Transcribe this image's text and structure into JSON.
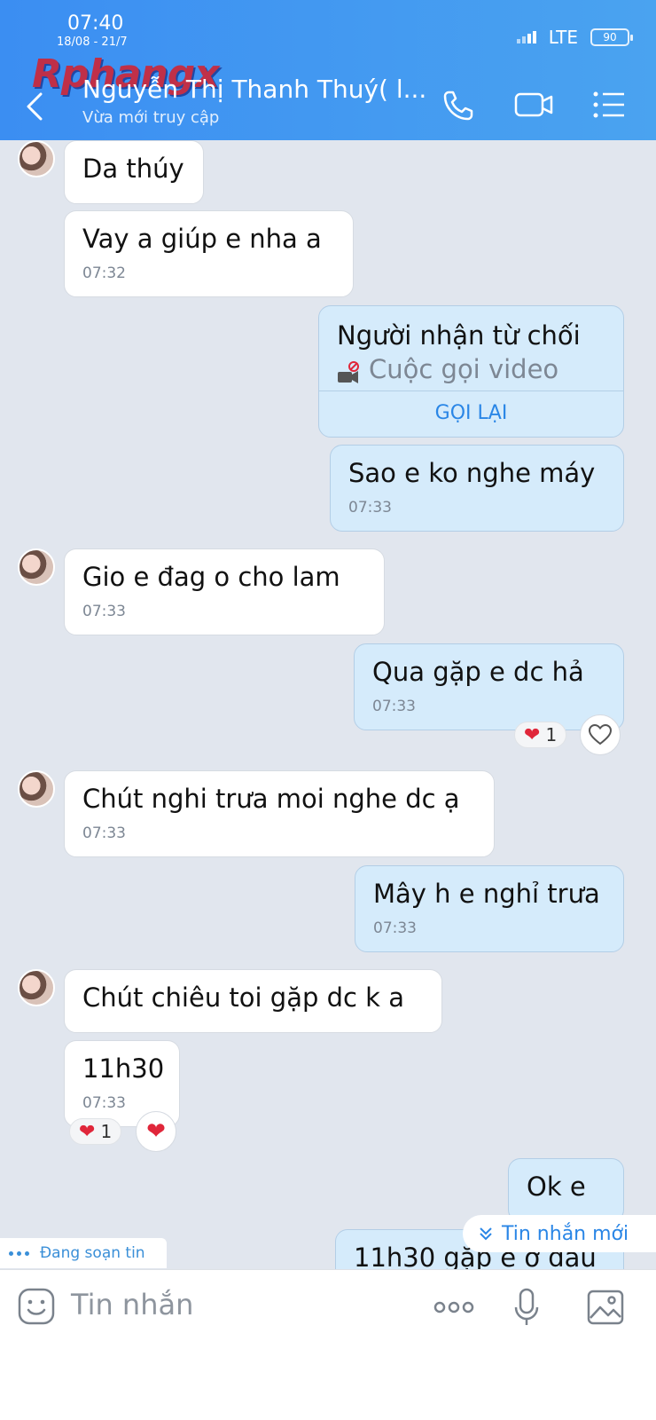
{
  "status": {
    "time": "07:40",
    "date": "18/08 - 21/7",
    "network": "LTE",
    "battery": "90"
  },
  "watermark": "Rphangx",
  "header": {
    "name": "Nguyễn Thị Thanh Thuý( l...",
    "presence": "Vừa mới truy cập"
  },
  "messages": {
    "m1": {
      "text": "Da thúy"
    },
    "m2": {
      "text": "Vay a giúp e nha a",
      "time": "07:32"
    },
    "missed_call": {
      "line1": "Người nhận từ chối",
      "line2": "Cuộc gọi video",
      "action": "GỌI LẠI"
    },
    "m3": {
      "text": "Sao e ko nghe máy",
      "time": "07:33"
    },
    "m4": {
      "text": "Gio e đag o cho lam",
      "time": "07:33"
    },
    "m5": {
      "text": "Qua gặp e dc hả",
      "time": "07:33",
      "reaction_count": "1"
    },
    "m6": {
      "text": "Chút nghi trưa moi nghe dc ạ",
      "time": "07:33"
    },
    "m7": {
      "text": "Mây h e nghỉ trưa",
      "time": "07:33"
    },
    "m8": {
      "text": "Chút chiêu toi gặp dc k a"
    },
    "m9": {
      "text": "11h30",
      "time": "07:33",
      "reaction_count": "1"
    },
    "m10": {
      "text": "Ok e"
    },
    "m11": {
      "text": "11h30 gặp e ở đâu"
    }
  },
  "typing_indicator": "Đang soạn tin",
  "new_message_label": "Tin nhắn mới",
  "input": {
    "placeholder": "Tin nhắn"
  },
  "colors": {
    "header": "#3b8ef2",
    "outgoing": "#d5ebfb",
    "incoming": "#ffffff",
    "accent": "#2a86e6",
    "heart": "#e0263a"
  },
  "icons": [
    "back-icon",
    "phone-icon",
    "video-icon",
    "menu-icon",
    "emoji-icon",
    "more-icon",
    "mic-icon",
    "image-icon",
    "heart-icon"
  ]
}
